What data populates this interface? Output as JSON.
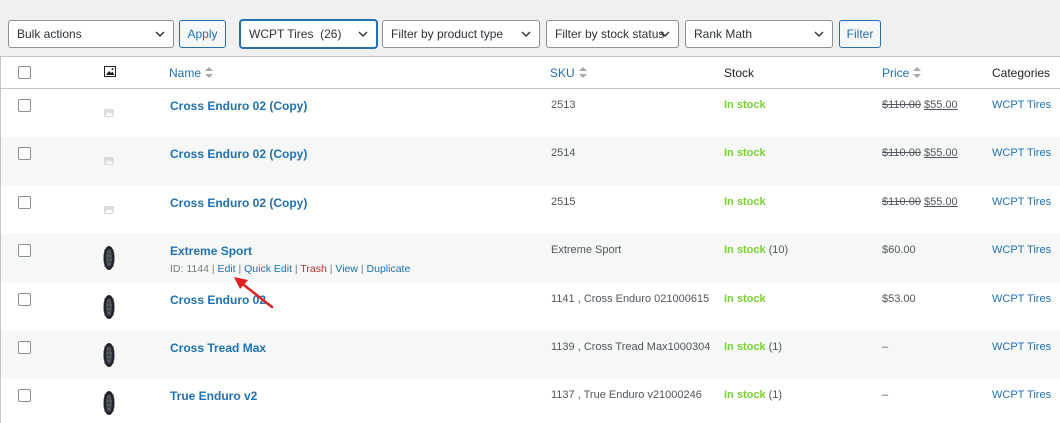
{
  "toolbar": {
    "bulk_actions": "Bulk actions",
    "apply": "Apply",
    "category_filter": "WCPT Tires  (26)",
    "product_type_filter": "Filter by product type",
    "stock_status_filter": "Filter by stock status",
    "rank_math_filter": "Rank Math",
    "filter": "Filter"
  },
  "table": {
    "headers": {
      "name": "Name",
      "sku": "SKU",
      "stock": "Stock",
      "price": "Price",
      "categories": "Categories"
    },
    "rows": [
      {
        "name": "Cross Enduro 02 (Copy)",
        "sku": "2513",
        "stock": "In stock",
        "qty": "",
        "price_old": "$110.00",
        "price_new": "$55.00",
        "price": "",
        "category": "WCPT Tires",
        "thumb": "placeholder"
      },
      {
        "name": "Cross Enduro 02 (Copy)",
        "sku": "2514",
        "stock": "In stock",
        "qty": "",
        "price_old": "$110.00",
        "price_new": "$55.00",
        "price": "",
        "category": "WCPT Tires",
        "thumb": "placeholder"
      },
      {
        "name": "Cross Enduro 02 (Copy)",
        "sku": "2515",
        "stock": "In stock",
        "qty": "",
        "price_old": "$110.00",
        "price_new": "$55.00",
        "price": "",
        "category": "WCPT Tires",
        "thumb": "placeholder"
      },
      {
        "name": "Extreme Sport",
        "sku": "Extreme Sport",
        "stock": "In stock",
        "qty": "(10)",
        "price_old": "",
        "price_new": "",
        "price": "$60.00",
        "category": "WCPT Tires",
        "thumb": "tire",
        "row_actions": {
          "id": "ID: 1144",
          "edit": "Edit",
          "quick_edit": "Quick Edit",
          "trash": "Trash",
          "view": "View",
          "duplicate": "Duplicate"
        }
      },
      {
        "name": "Cross Enduro 02",
        "sku": "1141 , Cross Enduro 021000615",
        "stock": "In stock",
        "qty": "",
        "price_old": "",
        "price_new": "",
        "price": "$53.00",
        "category": "WCPT Tires",
        "thumb": "tire"
      },
      {
        "name": "Cross Tread Max",
        "sku": "1139 , Cross Tread Max1000304",
        "stock": "In stock",
        "qty": "(1)",
        "price_old": "",
        "price_new": "",
        "price": "–",
        "category": "WCPT Tires",
        "thumb": "tire"
      },
      {
        "name": "True Enduro v2",
        "sku": "1137 , True Enduro v21000246",
        "stock": "In stock",
        "qty": "(1)",
        "price_old": "",
        "price_new": "",
        "price": "–",
        "category": "WCPT Tires",
        "thumb": "tire"
      }
    ]
  },
  "colors": {
    "accent": "#2271b1",
    "in_stock": "#7ad03a",
    "trash": "#b32d2e",
    "annotation_arrow": "#e02020"
  }
}
